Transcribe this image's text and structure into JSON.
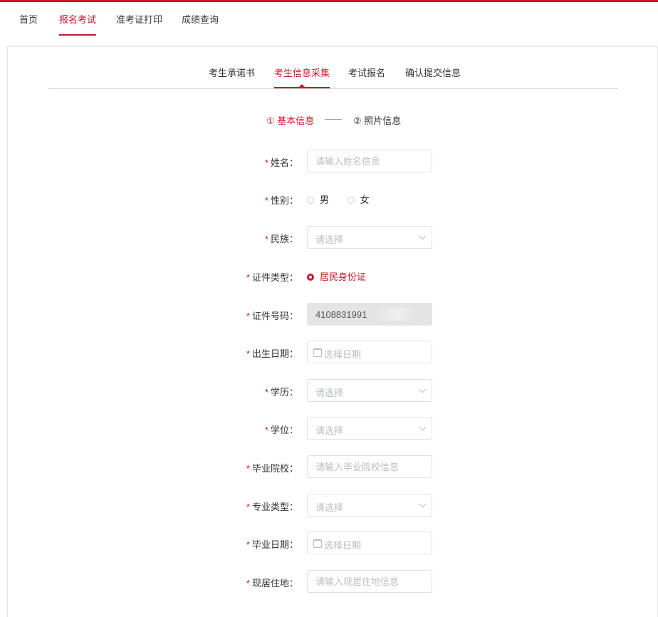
{
  "topnav": {
    "items": [
      "首页",
      "报名考试",
      "准考证打印",
      "成绩查询"
    ],
    "active_index": 1
  },
  "tabs": {
    "items": [
      "考生承诺书",
      "考生信息采集",
      "考试报名",
      "确认提交信息"
    ],
    "active_index": 1
  },
  "steps": {
    "step1": "① 基本信息",
    "step2": "② 照片信息",
    "active": 1
  },
  "form": {
    "name": {
      "label": "姓名：",
      "placeholder": "请输入姓名信息",
      "required": true
    },
    "gender": {
      "label": "性别：",
      "options": [
        "男",
        "女"
      ],
      "selected": null,
      "required": true
    },
    "ethnicity": {
      "label": "民族：",
      "placeholder": "请选择",
      "required": true
    },
    "id_type": {
      "label": "证件类型：",
      "option": "居民身份证",
      "selected": true,
      "required": true
    },
    "id_number": {
      "label": "证件号码：",
      "value": "4108831991",
      "required": true,
      "disabled": true
    },
    "birth_date": {
      "label": "出生日期：",
      "placeholder": "选择日期",
      "required": true
    },
    "education": {
      "label": "学历：",
      "placeholder": "请选择",
      "required": true
    },
    "degree": {
      "label": "学位：",
      "placeholder": "请选择",
      "required": true
    },
    "school": {
      "label": "毕业院校：",
      "placeholder": "请输入毕业院校信息",
      "required": true
    },
    "major_type": {
      "label": "专业类型：",
      "placeholder": "请选择",
      "required": true
    },
    "grad_date": {
      "label": "毕业日期：",
      "placeholder": "选择日期",
      "required": true
    },
    "address": {
      "label": "现居住地：",
      "placeholder": "请输入现居住地信息",
      "required": true
    }
  },
  "required_mark": "*",
  "colors": {
    "accent": "#c51a2b",
    "border": "#dcdfe6",
    "placeholder": "#b8bcc4"
  }
}
